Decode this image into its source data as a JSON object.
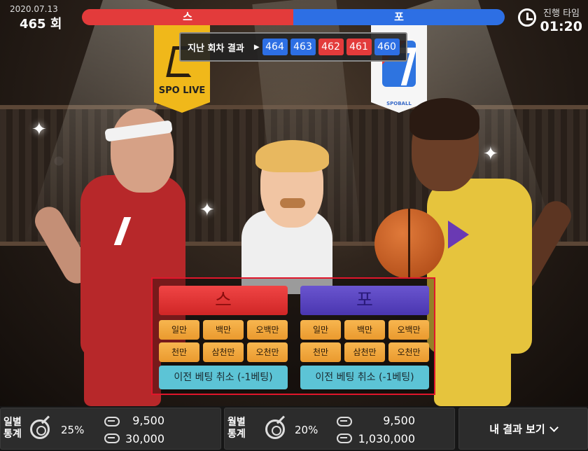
{
  "header": {
    "date": "2020.07.13",
    "round": "465 회",
    "team_left": "스",
    "team_right": "포",
    "timer_label": "진행 타임",
    "timer_value": "01:20"
  },
  "recent_results": {
    "label": "지난 회차 결과",
    "items": [
      {
        "value": "464",
        "color": "blue"
      },
      {
        "value": "463",
        "color": "blue"
      },
      {
        "value": "462",
        "color": "red"
      },
      {
        "value": "461",
        "color": "red"
      },
      {
        "value": "460",
        "color": "blue"
      }
    ]
  },
  "scene": {
    "banner_left": "SPO LIVE",
    "banner_right_sub": "SPOBALL"
  },
  "betting": {
    "left": {
      "team": "스",
      "amounts": [
        "일만",
        "백만",
        "오백만",
        "천만",
        "삼천만",
        "오천만"
      ],
      "cancel": "이전 베팅 취소 (-1베팅)"
    },
    "right": {
      "team": "포",
      "amounts": [
        "일만",
        "백만",
        "오백만",
        "천만",
        "삼천만",
        "오천만"
      ],
      "cancel": "이전 베팅 취소 (-1베팅)"
    }
  },
  "stats": {
    "daily": {
      "label": "일별 통계",
      "percent": "25%",
      "value1": "9,500",
      "value2": "30,000"
    },
    "monthly": {
      "label": "월별 통계",
      "percent": "20%",
      "value1": "9,500",
      "value2": "1,030,000"
    },
    "my_results": "내 결과 보기"
  },
  "colors": {
    "red": "#e33b3b",
    "blue": "#2d6fe4",
    "purple": "#5a45c0",
    "orange": "#f0a840",
    "cyan": "#5cc4d6",
    "panel_border": "#e0162b"
  }
}
